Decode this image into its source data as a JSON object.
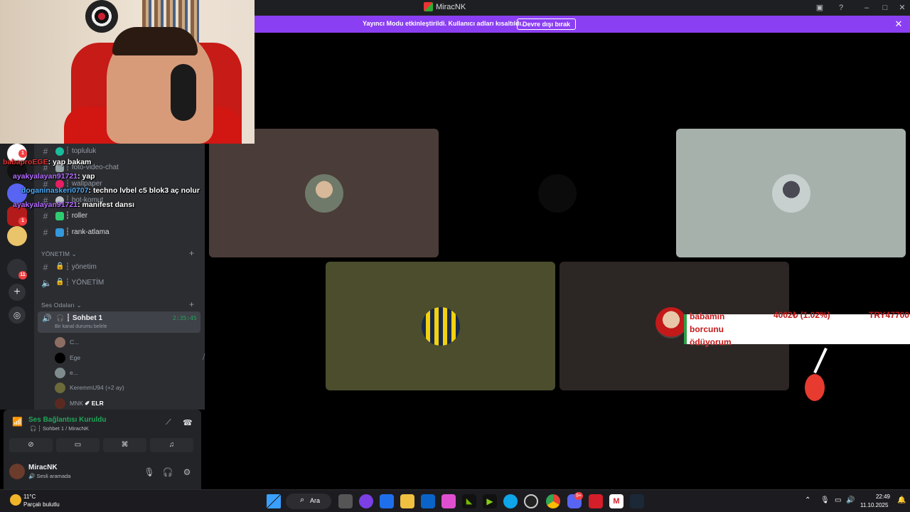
{
  "window": {
    "title": "MiracNK"
  },
  "banner": {
    "message": "Yayıncı Modu etkinleştirildi. Kullanıcı adları kısaltıldı.",
    "button_label": "Devre dışı bırak"
  },
  "chat": [
    {
      "user": "babaproEGE",
      "text": ": yap bakam"
    },
    {
      "user": "ayakyalayan91721",
      "text": ": yap"
    },
    {
      "user": "doganinaskeri0707",
      "text": ": techno lvbel c5 blok3 aç nolur"
    },
    {
      "user": "ayakyalayan91721",
      "text": ": manifest dansı"
    }
  ],
  "rail": {
    "badges": [
      "1",
      "1",
      "11"
    ]
  },
  "channels": {
    "text": [
      {
        "name": "topluluk"
      },
      {
        "name": "foto-video-chat"
      },
      {
        "name": "wallpaper"
      },
      {
        "name": "bot-komut"
      },
      {
        "name": "roller"
      },
      {
        "name": "rank-atlama"
      }
    ],
    "yonetim_category": "YÖNETİM",
    "yonetim": [
      {
        "name": "yönetim"
      },
      {
        "name": "YÖNETİM"
      }
    ],
    "voice_category": "Ses Odaları",
    "active_voice": {
      "name": "Sohbet 1",
      "timer": "2:35:45",
      "status": "Bir kanal durumu belirle"
    },
    "voice_users": [
      {
        "name": "C..."
      },
      {
        "name": "Ege"
      },
      {
        "name": "e..."
      },
      {
        "name": "KeremmU94 (+2 ay)"
      },
      {
        "name": "MNK",
        "tag": "ELR"
      }
    ]
  },
  "voice_panel": {
    "status": "Ses Bağlantısı Kuruldu",
    "sub": "Sohbet 1 / MiracNK"
  },
  "user_panel": {
    "name": "MiracNK",
    "status": "Sesli aramada"
  },
  "donation": {
    "text": "babamın borcunu ödüyorum",
    "amount": "4002₺ (1.02%)",
    "currency": "TRY47700"
  },
  "taskbar": {
    "temperature": "11°C",
    "condition": "Parçalı bulutlu",
    "search_label": "Ara",
    "time": "22:49",
    "date": "11.10.2025",
    "discord_badge": "9+"
  },
  "colors": {
    "banner": "#8b3ff2",
    "tile1": "#4a3c38",
    "tile3": "#a7b1ab",
    "tile4": "#4b4d2d",
    "tile5": "#2c2624",
    "online": "#23a55a"
  }
}
